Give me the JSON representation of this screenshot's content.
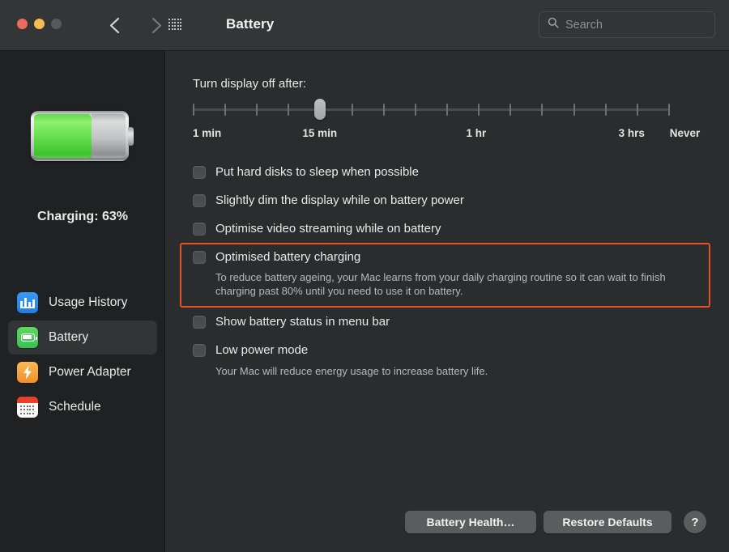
{
  "window": {
    "title": "Battery",
    "traffic_lights": [
      {
        "name": "close",
        "color": "#ec6a5e"
      },
      {
        "name": "minimize",
        "color": "#f5bd4f"
      },
      {
        "name": "zoom",
        "color": "#58595a"
      }
    ],
    "nav": {
      "back": "back-chevron",
      "forward": "forward-chevron"
    },
    "grid_button": "show-all-preferences"
  },
  "search": {
    "placeholder": "Search",
    "value": "",
    "icon": "search-icon"
  },
  "sidebar": {
    "battery_icon": "battery-graphic",
    "battery_percent": 63,
    "status": "Charging: 63%",
    "items": [
      {
        "label": "Usage History",
        "icon": "bar-chart-icon",
        "icon_color": "#2f8ef0",
        "selected": false
      },
      {
        "label": "Battery",
        "icon": "battery-icon",
        "icon_color": "#4acb58",
        "selected": true
      },
      {
        "label": "Power Adapter",
        "icon": "bolt-icon",
        "icon_color": "#f5a43a",
        "selected": false
      },
      {
        "label": "Schedule",
        "icon": "calendar-icon",
        "icon_color": "#e8402a",
        "selected": false
      }
    ]
  },
  "main": {
    "slider_title": "Turn display off after:",
    "slider": {
      "tick_count": 16,
      "value_index": 4,
      "value_label": "15 min",
      "labels": [
        {
          "text": "1 min",
          "position_pct": 0
        },
        {
          "text": "15 min",
          "position_pct": 26.7
        },
        {
          "text": "1 hr",
          "position_pct": 59.6
        },
        {
          "text": "3 hrs",
          "position_pct": 92.3
        },
        {
          "text": "Never",
          "position_pct": 103.5
        }
      ]
    },
    "options": [
      {
        "label": "Put hard disks to sleep when possible",
        "checked": false
      },
      {
        "label": "Slightly dim the display while on battery power",
        "checked": false
      },
      {
        "label": "Optimise video streaming while on battery",
        "checked": false
      },
      {
        "label": "Optimised battery charging",
        "checked": false,
        "description": "To reduce battery ageing, your Mac learns from your daily charging routine so it can wait to finish charging past 80% until you need to use it on battery."
      },
      {
        "label": "Show battery status in menu bar",
        "checked": false
      },
      {
        "label": "Low power mode",
        "checked": false,
        "description": "Your Mac will reduce energy usage to increase battery life."
      }
    ],
    "highlight": {
      "target": "Optimised battery charging",
      "color": "#e8502a"
    },
    "buttons": {
      "battery_health": "Battery Health…",
      "restore_defaults": "Restore Defaults",
      "help": "?"
    }
  }
}
